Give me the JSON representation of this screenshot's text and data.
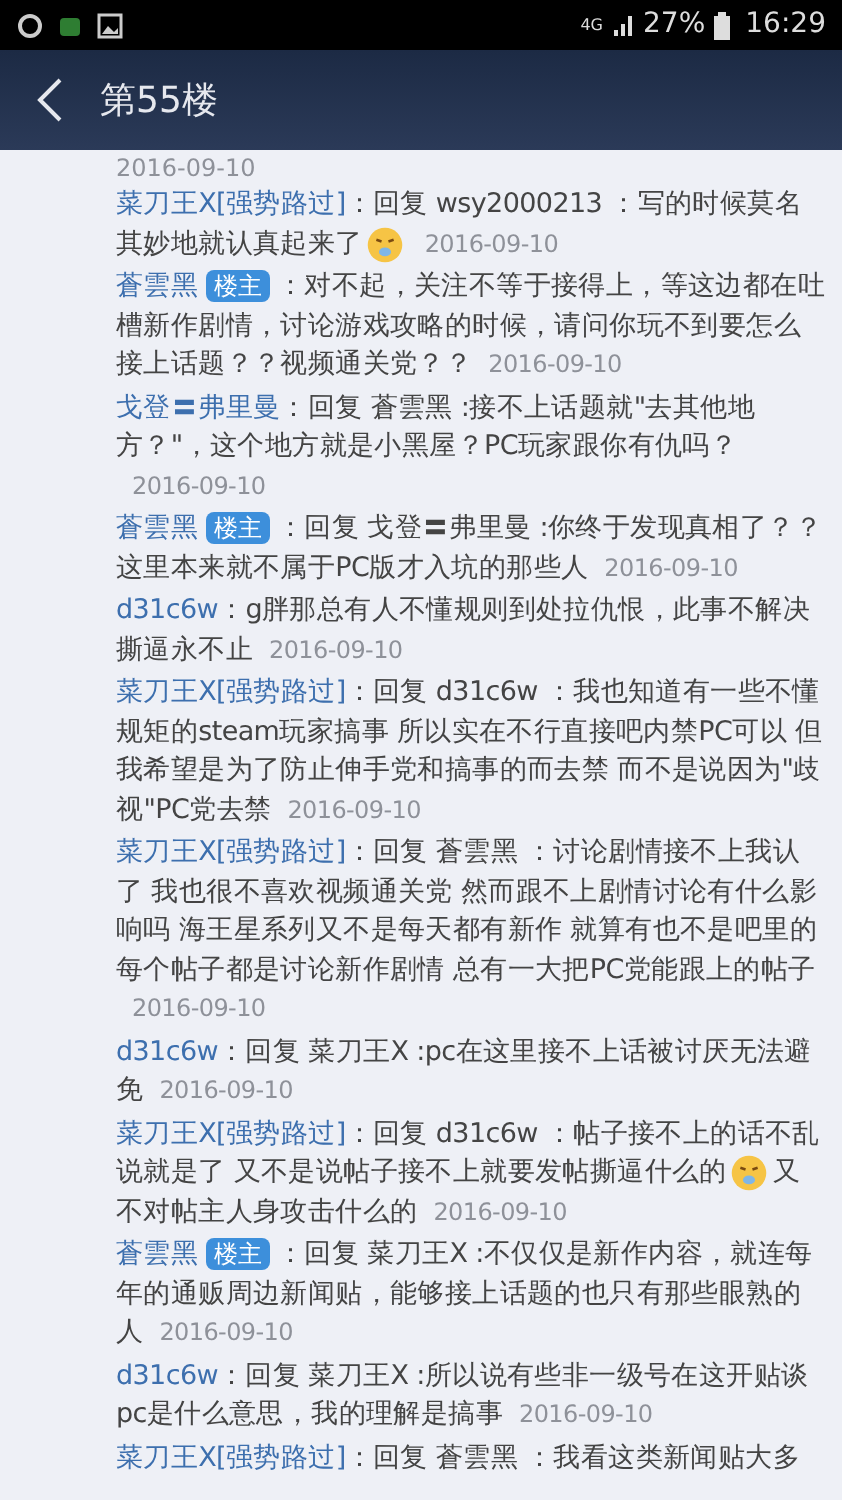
{
  "status_bar": {
    "network": "4G",
    "battery": "27%",
    "time": "16:29"
  },
  "header": {
    "title": "第55楼"
  },
  "top_date": "2016-09-10",
  "comments": [
    {
      "author": "菜刀王X[强势路过]",
      "op": false,
      "text": "：回复 wsy2000213 ：写的时候莫名其妙地就认真起来了",
      "emoji": true,
      "date": "2016-09-10"
    },
    {
      "author": "蒼雲黑",
      "op": true,
      "badge": "楼主",
      "text": "：对不起，关注不等于接得上，等这边都在吐槽新作剧情，讨论游戏攻略的时候，请问你玩不到要怎么接上话题？？视频通关党？？",
      "emoji": false,
      "date": "2016-09-10"
    },
    {
      "author": "戈登〓弗里曼",
      "op": false,
      "text": "：回复 蒼雲黑 :接不上话题就\"去其他地方？\"，这个地方就是小黑屋？PC玩家跟你有仇吗？",
      "emoji": false,
      "date": "2016-09-10"
    },
    {
      "author": "蒼雲黑",
      "op": true,
      "badge": "楼主",
      "text": "：回复 戈登〓弗里曼 :你终于发现真相了？？这里本来就不属于PC版才入坑的那些人",
      "emoji": false,
      "date": "2016-09-10"
    },
    {
      "author": "d31c6w",
      "op": false,
      "text": "：g胖那总有人不懂规则到处拉仇恨，此事不解决撕逼永不止",
      "emoji": false,
      "date": "2016-09-10"
    },
    {
      "author": "菜刀王X[强势路过]",
      "op": false,
      "text": "：回复 d31c6w ：我也知道有一些不懂规矩的steam玩家搞事 所以实在不行直接吧内禁PC可以 但我希望是为了防止伸手党和搞事的而去禁 而不是说因为\"歧视\"PC党去禁",
      "emoji": false,
      "date": "2016-09-10"
    },
    {
      "author": "菜刀王X[强势路过]",
      "op": false,
      "text": "：回复 蒼雲黑 ：讨论剧情接不上我认了 我也很不喜欢视频通关党 然而跟不上剧情讨论有什么影响吗 海王星系列又不是每天都有新作 就算有也不是吧里的每个帖子都是讨论新作剧情 总有一大把PC党能跟上的帖子",
      "emoji": false,
      "date": "2016-09-10"
    },
    {
      "author": "d31c6w",
      "op": false,
      "text": "：回复 菜刀王X :pc在这里接不上话被讨厌无法避免",
      "emoji": false,
      "date": "2016-09-10"
    },
    {
      "author": "菜刀王X[强势路过]",
      "op": false,
      "text": "：回复 d31c6w ：帖子接不上的话不乱说就是了 又不是说帖子接不上就要发帖撕逼什么的",
      "emoji": true,
      "after": "又不对帖主人身攻击什么的",
      "date": "2016-09-10"
    },
    {
      "author": "蒼雲黑",
      "op": true,
      "badge": "楼主",
      "text": "：回复 菜刀王X :不仅仅是新作内容，就连每年的通贩周边新闻贴，能够接上话题的也只有那些眼熟的人",
      "emoji": false,
      "date": "2016-09-10"
    },
    {
      "author": "d31c6w",
      "op": false,
      "text": "：回复 菜刀王X :所以说有些非一级号在这开贴谈pc是什么意思，我的理解是搞事",
      "emoji": false,
      "date": "2016-09-10"
    },
    {
      "author": "菜刀王X[强势路过]",
      "op": false,
      "text": "：回复 蒼雲黑 ：我看这类新闻贴大多",
      "emoji": false
    }
  ]
}
